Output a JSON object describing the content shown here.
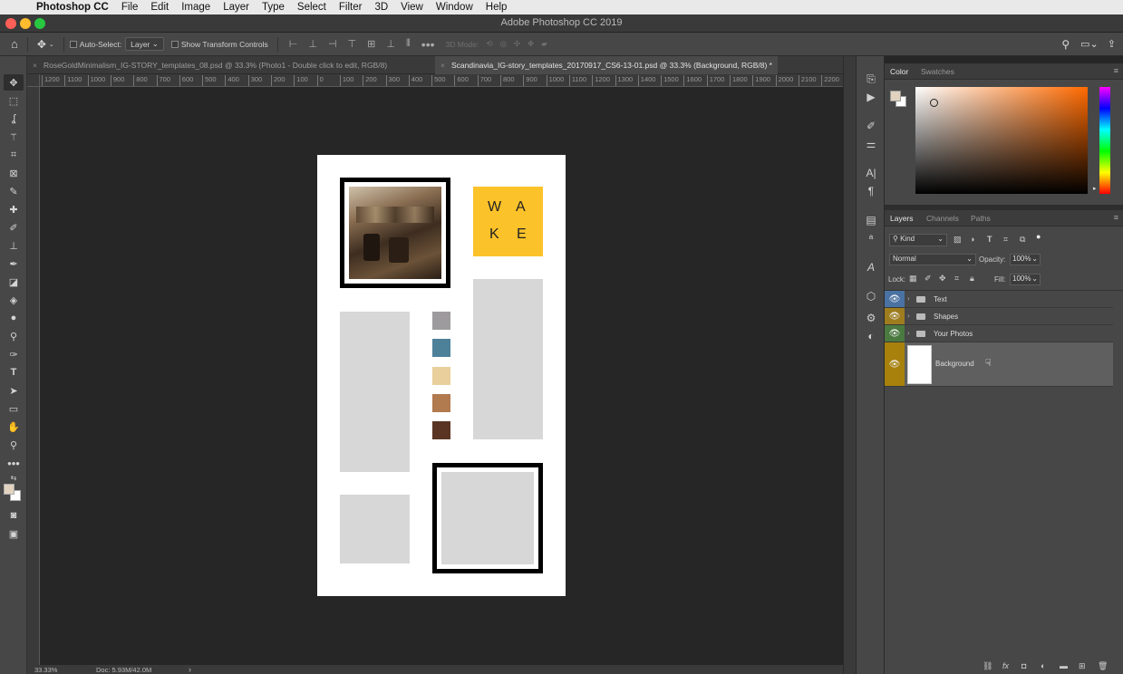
{
  "menubar": {
    "app": "Photoshop CC",
    "items": [
      "File",
      "Edit",
      "Image",
      "Layer",
      "Type",
      "Select",
      "Filter",
      "3D",
      "View",
      "Window",
      "Help"
    ]
  },
  "window": {
    "title": "Adobe Photoshop CC 2019"
  },
  "options": {
    "auto_select": "Auto-Select:",
    "layer_select": "Layer",
    "show_transform": "Show Transform Controls",
    "mode_3d": "3D Mode:"
  },
  "tabs": [
    {
      "label": "RoseGoldMinimalism_IG-STORY_templates_08.psd @ 33.3% (Photo1 - Double click to edit, RGB/8)",
      "close": "×",
      "active": false
    },
    {
      "label": "Scandinavia_IG-story_templates_20170917_CS6-13-01.psd @ 33.3% (Background, RGB/8) *",
      "close": "×",
      "active": true
    }
  ],
  "ruler_h": [
    "1200",
    "1100",
    "1000",
    "900",
    "800",
    "700",
    "600",
    "500",
    "400",
    "300",
    "200",
    "100",
    "0",
    "100",
    "200",
    "300",
    "400",
    "500",
    "600",
    "700",
    "800",
    "900",
    "1000",
    "1100",
    "1200",
    "1300",
    "1400",
    "1500",
    "1600",
    "1700",
    "1800",
    "1900",
    "2000",
    "2100",
    "2200"
  ],
  "status": {
    "zoom": "33.33%",
    "doc": "Doc: 5.93M/42.0M",
    "arrow": "›"
  },
  "document": {
    "wake_letters": [
      "W",
      "A",
      "K",
      "E"
    ],
    "wake_color": "#fcc22a",
    "placeholder_color": "#d8d7d8",
    "swatches": [
      "#9e9b9e",
      "#4d8199",
      "#e9cf9b",
      "#b17a4f",
      "#5a3524"
    ]
  },
  "color_panel": {
    "tabs": [
      "Color",
      "Swatches"
    ],
    "menu": "≡"
  },
  "layers_panel": {
    "tabs": [
      "Layers",
      "Channels",
      "Paths"
    ],
    "menu": "≡",
    "filter": "Kind",
    "blend_mode": "Normal",
    "opacity_label": "Opacity:",
    "opacity_value": "100%",
    "lock_label": "Lock:",
    "fill_label": "Fill:",
    "fill_value": "100%",
    "layers": [
      {
        "name": "Text",
        "color": "#4a73a3",
        "type": "group"
      },
      {
        "name": "Shapes",
        "color": "#9e7d1f",
        "type": "group"
      },
      {
        "name": "Your Photos",
        "color": "#4b7a41",
        "type": "group"
      },
      {
        "name": "Background",
        "color": "#a7810c",
        "type": "image"
      }
    ]
  }
}
